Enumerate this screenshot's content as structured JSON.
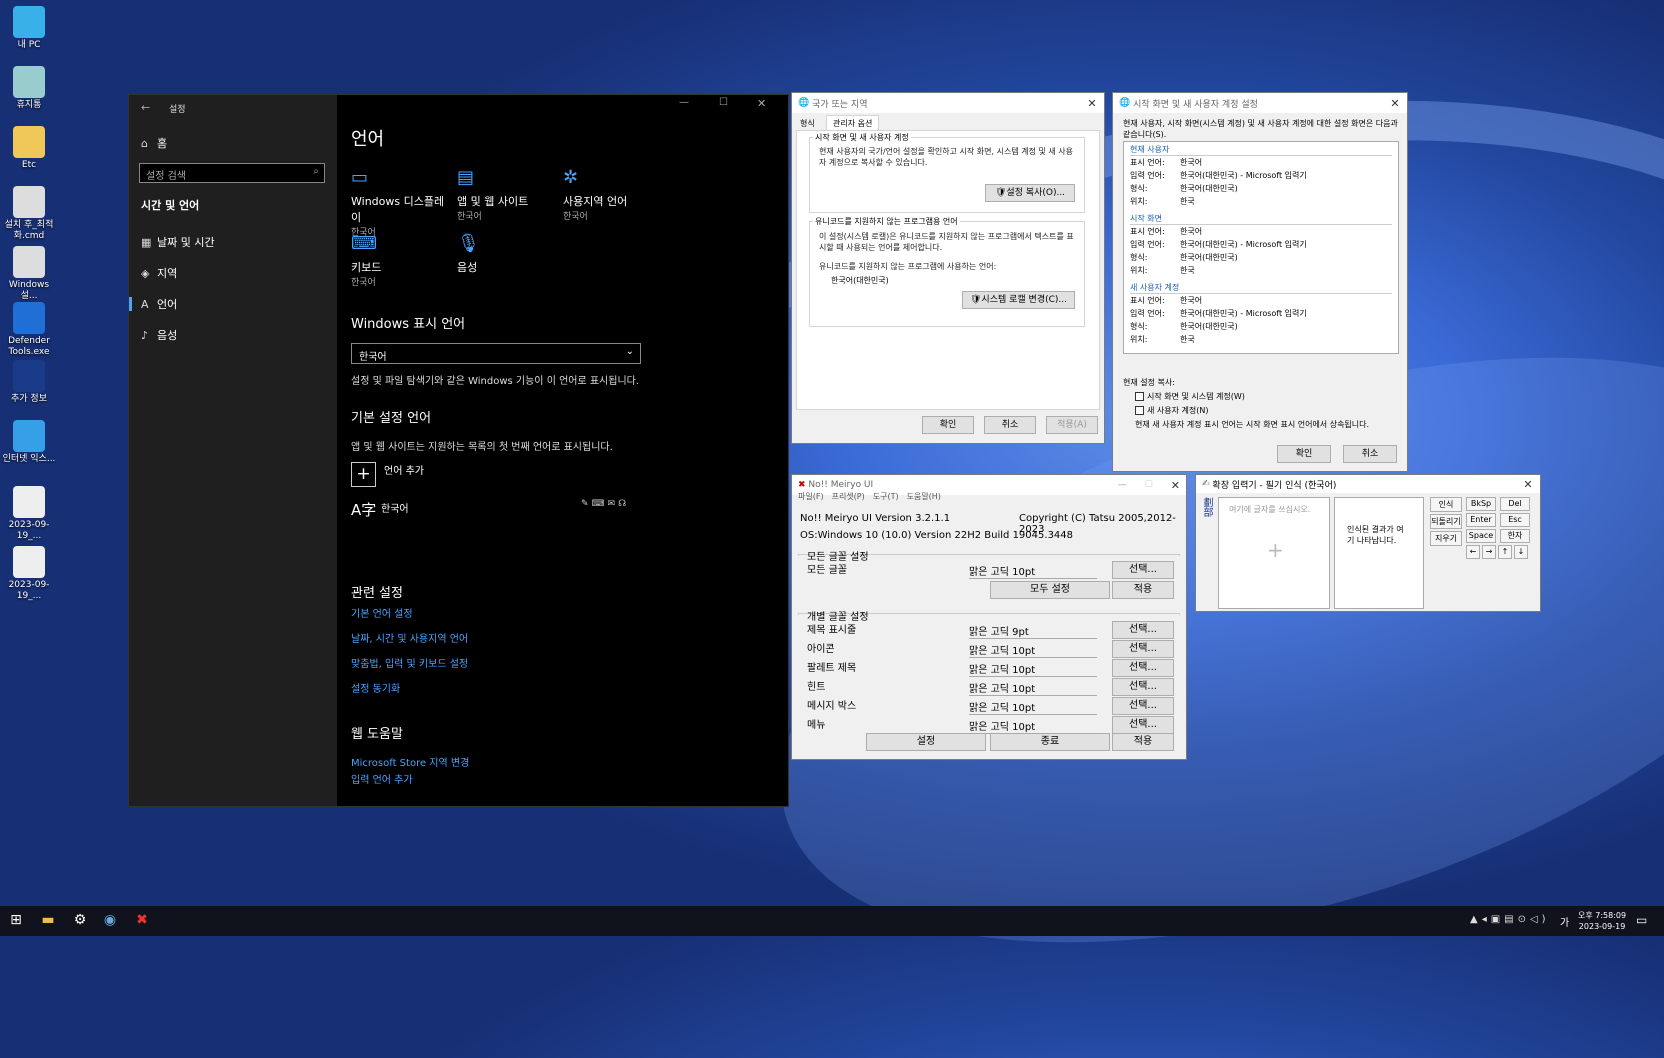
{
  "desktop": {
    "icons": [
      {
        "label": "내 PC",
        "icon": "monitor-icon"
      },
      {
        "label": "휴지통",
        "icon": "recycle-bin-icon"
      },
      {
        "label": "Etc",
        "icon": "folder-icon"
      },
      {
        "label": "설치 후_최적화.cmd",
        "icon": "gear-file-icon"
      },
      {
        "label": "Windows 설...",
        "icon": "gear-file-icon"
      },
      {
        "label": "Defender Tools.exe",
        "icon": "shield-icon"
      },
      {
        "label": "추가 정보",
        "icon": "globe-icon"
      },
      {
        "label": "인터넷 익스...",
        "icon": "ie-icon"
      },
      {
        "label": "2023-09-19_...",
        "icon": "screenshot-icon"
      },
      {
        "label": "2023-09-19_...",
        "icon": "screenshot-icon"
      }
    ]
  },
  "settings": {
    "title": "설정",
    "home": "홈",
    "search_placeholder": "설정 검색",
    "section": "시간 및 언어",
    "nav": [
      {
        "label": "날짜 및 시간",
        "icon": "calendar-clock-icon"
      },
      {
        "label": "지역",
        "icon": "region-icon"
      },
      {
        "label": "언어",
        "icon": "language-icon"
      },
      {
        "label": "음성",
        "icon": "microphone-icon"
      }
    ],
    "page_title": "언어",
    "tiles": [
      {
        "label": "Windows 디스플레이",
        "sub": "한국어",
        "icon": "laptop-icon"
      },
      {
        "label": "앱 및 웹 사이트",
        "sub": "한국어",
        "icon": "window-icon"
      },
      {
        "label": "사용지역 언어",
        "sub": "한국어",
        "icon": "globe-lang-icon"
      },
      {
        "label": "키보드",
        "sub": "한국어",
        "icon": "keyboard-icon"
      },
      {
        "label": "음성",
        "sub": "",
        "icon": "microphone-icon"
      }
    ],
    "display_lang_heading": "Windows 표시 언어",
    "display_lang_value": "한국어",
    "display_lang_desc": "설정 및 파일 탐색기와 같은 Windows 기능이 이 언어로 표시됩니다.",
    "pref_heading": "기본 설정 언어",
    "pref_desc": "앱 및 웹 사이트는 지원하는 목록의 첫 번째 언어로 표시됩니다.",
    "add_lang": "언어 추가",
    "lang_item": "한국어",
    "related_heading": "관련 설정",
    "related_links": [
      "기본 언어 설정",
      "날짜, 시간 및 사용지역 언어",
      "맞춤법, 입력 및 키보드 설정",
      "설정 동기화"
    ],
    "help_heading": "웹 도움말",
    "help_links": [
      "Microsoft Store 지역 변경",
      "입력 언어 추가"
    ]
  },
  "region": {
    "title": "국가 또는 지역",
    "tabs": [
      "형식",
      "관리자 옵션"
    ],
    "group1_title": "시작 화면 및 새 사용자 계정",
    "group1_text": "현재 사용자의 국가/언어 설정을 확인하고 시작 화면, 시스템 계정 및 새 사용자 계정으로 복사할 수 있습니다.",
    "copy_btn": "설정 복사(O)...",
    "group2_title": "유니코드를 지원하지 않는 프로그램용 언어",
    "group2_text": "이 설정(시스템 로캘)은 유니코드를 지원하지 않는 프로그램에서 텍스트를 표시할 때 사용되는 언어를 제어합니다.",
    "group2_label": "유니코드를 지원하지 않는 프로그램에 사용하는 언어:",
    "group2_value": "한국어(대한민국)",
    "locale_btn": "시스템 로캘 변경(C)...",
    "ok": "확인",
    "cancel": "취소",
    "apply": "적용(A)"
  },
  "welcome": {
    "title": "시작 화면 및 새 사용자 계정 설정",
    "intro": "현재 사용자, 시작 화면(시스템 계정) 및 새 사용자 계정에 대한 설정 화면은 다음과 같습니다(S).",
    "sections": [
      {
        "name": "현재 사용자",
        "rows": [
          [
            "표시 언어:",
            "한국어"
          ],
          [
            "입력 언어:",
            "한국어(대한민국) - Microsoft 입력기"
          ],
          [
            "형식:",
            "한국어(대한민국)"
          ],
          [
            "위치:",
            "한국"
          ]
        ]
      },
      {
        "name": "시작 화면",
        "rows": [
          [
            "표시 언어:",
            "한국어"
          ],
          [
            "입력 언어:",
            "한국어(대한민국) - Microsoft 입력기"
          ],
          [
            "형식:",
            "한국어(대한민국)"
          ],
          [
            "위치:",
            "한국"
          ]
        ]
      },
      {
        "name": "새 사용자 계정",
        "rows": [
          [
            "표시 언어:",
            "한국어"
          ],
          [
            "입력 언어:",
            "한국어(대한민국) - Microsoft 입력기"
          ],
          [
            "형식:",
            "한국어(대한민국)"
          ],
          [
            "위치:",
            "한국"
          ]
        ]
      }
    ],
    "copy_label": "현재 설정 복사:",
    "cb1": "시작 화면 및 시스템 계정(W)",
    "cb2": "새 사용자 계정(N)",
    "note": "현재 새 사용자 계정 표시 언어는 시작 화면 표시 언어에서 상속됩니다.",
    "ok": "확인",
    "cancel": "취소"
  },
  "meiryo": {
    "title": "No!! Meiryo UI",
    "menus": [
      "파일(F)",
      "프리셋(P)",
      "도구(T)",
      "도움말(H)"
    ],
    "version": "No!! Meiryo UI Version 3.2.1.1",
    "copyright": "Copyright (C) Tatsu 2005,2012-2023",
    "os": "OS:Windows 10 (10.0) Version 22H2 Build 19045.3448",
    "all_group": "모든 글꼴 설정",
    "all_label": "모든 글꼴",
    "all_font": "맑은 고딕  10pt",
    "select": "선택...",
    "all_set": "모두 설정",
    "apply": "적용",
    "ind_group": "개별 글꼴 설정",
    "items": [
      {
        "label": "제목 표시줄",
        "font": "맑은 고딕  9pt"
      },
      {
        "label": "아이콘",
        "font": "맑은 고딕  10pt"
      },
      {
        "label": "팔레트 제목",
        "font": "맑은 고딕  10pt"
      },
      {
        "label": "힌트",
        "font": "맑은 고딕  10pt"
      },
      {
        "label": "메시지 박스",
        "font": "맑은 고딕  10pt"
      },
      {
        "label": "메뉴",
        "font": "맑은 고딕  10pt"
      }
    ],
    "set": "설정",
    "exit": "종료"
  },
  "handwriting": {
    "title": "확장 입력기 - 필기 인식 (한국어)",
    "placeholder": "여기에 글자를 쓰십시오.",
    "result": "인식된 결과가 여기 나타납니다.",
    "mid_buttons": [
      "인식",
      "되돌리기",
      "지우기"
    ],
    "keys": [
      "BkSp",
      "Del",
      "Enter",
      "Esc",
      "Space",
      "한자",
      "←",
      "→",
      "↑",
      "↓"
    ],
    "side": "劃部"
  },
  "taskbar": {
    "time": "오후 7:58:09",
    "date": "2023-09-19",
    "ime": "가"
  }
}
